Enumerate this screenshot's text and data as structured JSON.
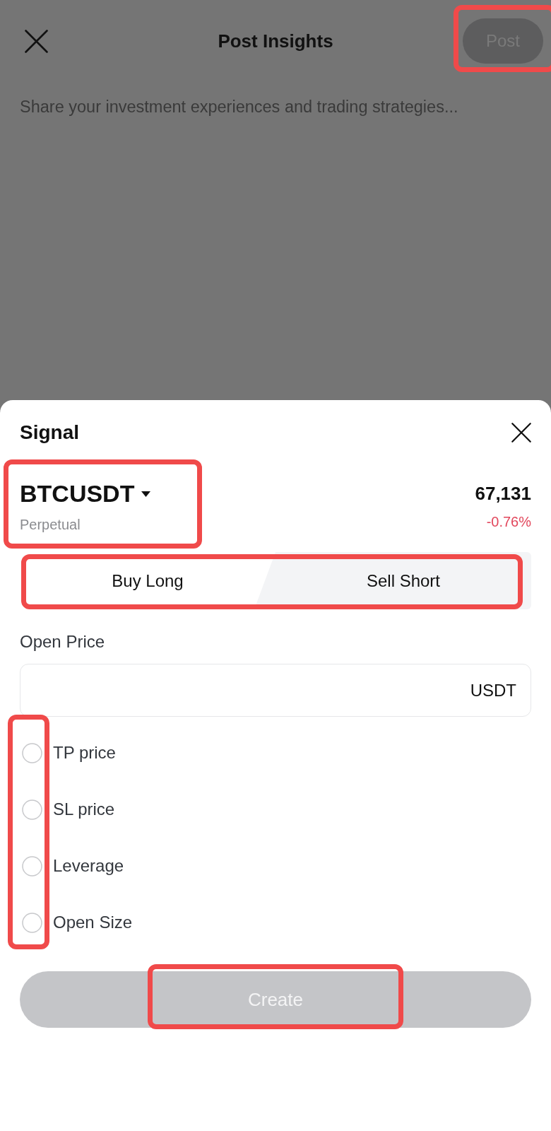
{
  "header": {
    "title": "Post Insights",
    "post_button": {
      "label": "Post",
      "disabled": true
    }
  },
  "composer": {
    "placeholder": "Share your investment experiences and trading strategies..."
  },
  "signal_sheet": {
    "title": "Signal",
    "instrument": {
      "symbol": "BTCUSDT",
      "type": "Perpetual"
    },
    "quote": {
      "price": "67,131",
      "change": "-0.76%"
    },
    "sides": [
      {
        "label": "Buy Long",
        "selected": true
      },
      {
        "label": "Sell Short",
        "selected": false
      }
    ],
    "open_price": {
      "label": "Open Price",
      "unit": "USDT"
    },
    "options": [
      {
        "label": "TP price",
        "checked": false
      },
      {
        "label": "SL price",
        "checked": false
      },
      {
        "label": "Leverage",
        "checked": false
      },
      {
        "label": "Open Size",
        "checked": false
      }
    ],
    "create_button": {
      "label": "Create",
      "disabled": true
    }
  }
}
